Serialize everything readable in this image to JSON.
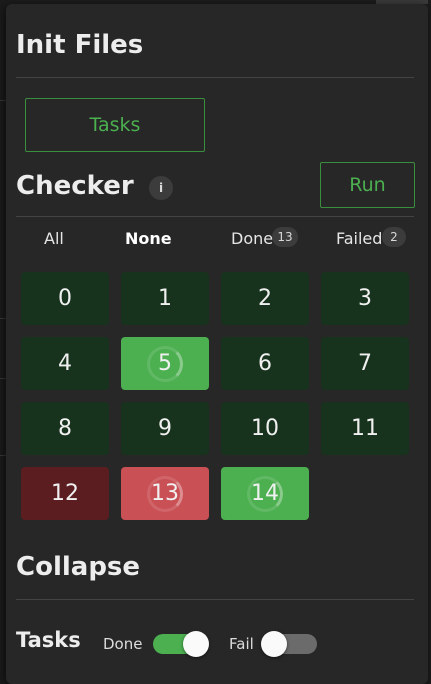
{
  "init_files": {
    "title": "Init Files",
    "tasks_button": "Tasks"
  },
  "checker": {
    "title": "Checker",
    "info_icon": "info-icon",
    "info_glyph": "i",
    "run_button": "Run",
    "filters": [
      {
        "label": "All",
        "active": false
      },
      {
        "label": "None",
        "active": true
      },
      {
        "label": "Done",
        "count": "13",
        "active": false
      },
      {
        "label": "Failed",
        "count": "2",
        "active": false
      }
    ],
    "cells": [
      {
        "label": "0",
        "status": "done"
      },
      {
        "label": "1",
        "status": "done"
      },
      {
        "label": "2",
        "status": "done"
      },
      {
        "label": "3",
        "status": "done"
      },
      {
        "label": "4",
        "status": "done"
      },
      {
        "label": "5",
        "status": "running-ok"
      },
      {
        "label": "6",
        "status": "done"
      },
      {
        "label": "7",
        "status": "done"
      },
      {
        "label": "8",
        "status": "done"
      },
      {
        "label": "9",
        "status": "done"
      },
      {
        "label": "10",
        "status": "done"
      },
      {
        "label": "11",
        "status": "done"
      },
      {
        "label": "12",
        "status": "failed"
      },
      {
        "label": "13",
        "status": "running-fail"
      },
      {
        "label": "14",
        "status": "running-ok"
      }
    ]
  },
  "collapse": {
    "title": "Collapse",
    "tasks_label": "Tasks",
    "done_toggle": {
      "label": "Done",
      "on": true
    },
    "fail_toggle": {
      "label": "Fail",
      "on": false
    }
  },
  "colors": {
    "accent": "#4caf50",
    "done_cell": "#18331d",
    "failed_cell": "#5b1d1f",
    "running_fail_cell": "#c95055"
  }
}
